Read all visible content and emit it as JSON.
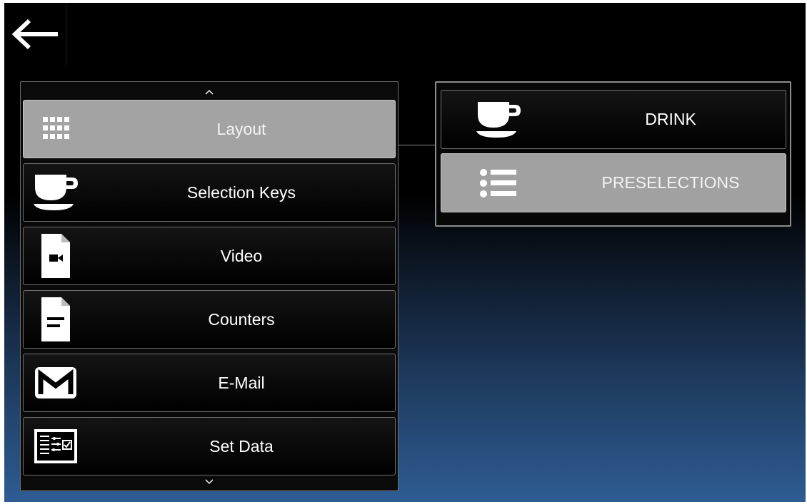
{
  "navigation": {
    "back_icon": "arrow-left-icon"
  },
  "menu": {
    "scroll_up_icon": "chevron-up-icon",
    "scroll_down_icon": "chevron-down-icon",
    "items": [
      {
        "label": "Layout",
        "icon": "grid-icon",
        "selected": true
      },
      {
        "label": "Selection Keys",
        "icon": "cup-icon",
        "selected": false
      },
      {
        "label": "Video",
        "icon": "video-file-icon",
        "selected": false
      },
      {
        "label": "Counters",
        "icon": "document-icon",
        "selected": false
      },
      {
        "label": "E-Mail",
        "icon": "mail-icon",
        "selected": false
      },
      {
        "label": "Set Data",
        "icon": "settings-checklist-icon",
        "selected": false
      }
    ]
  },
  "submenu": {
    "items": [
      {
        "label": "DRINK",
        "icon": "cup-icon",
        "selected": false
      },
      {
        "label": "PRESELECTIONS",
        "icon": "list-icon",
        "selected": true
      }
    ]
  },
  "colors": {
    "selected_background": "#a3a3a3",
    "item_background": "#000000",
    "background_gradient_bottom": "#2e5c92"
  }
}
